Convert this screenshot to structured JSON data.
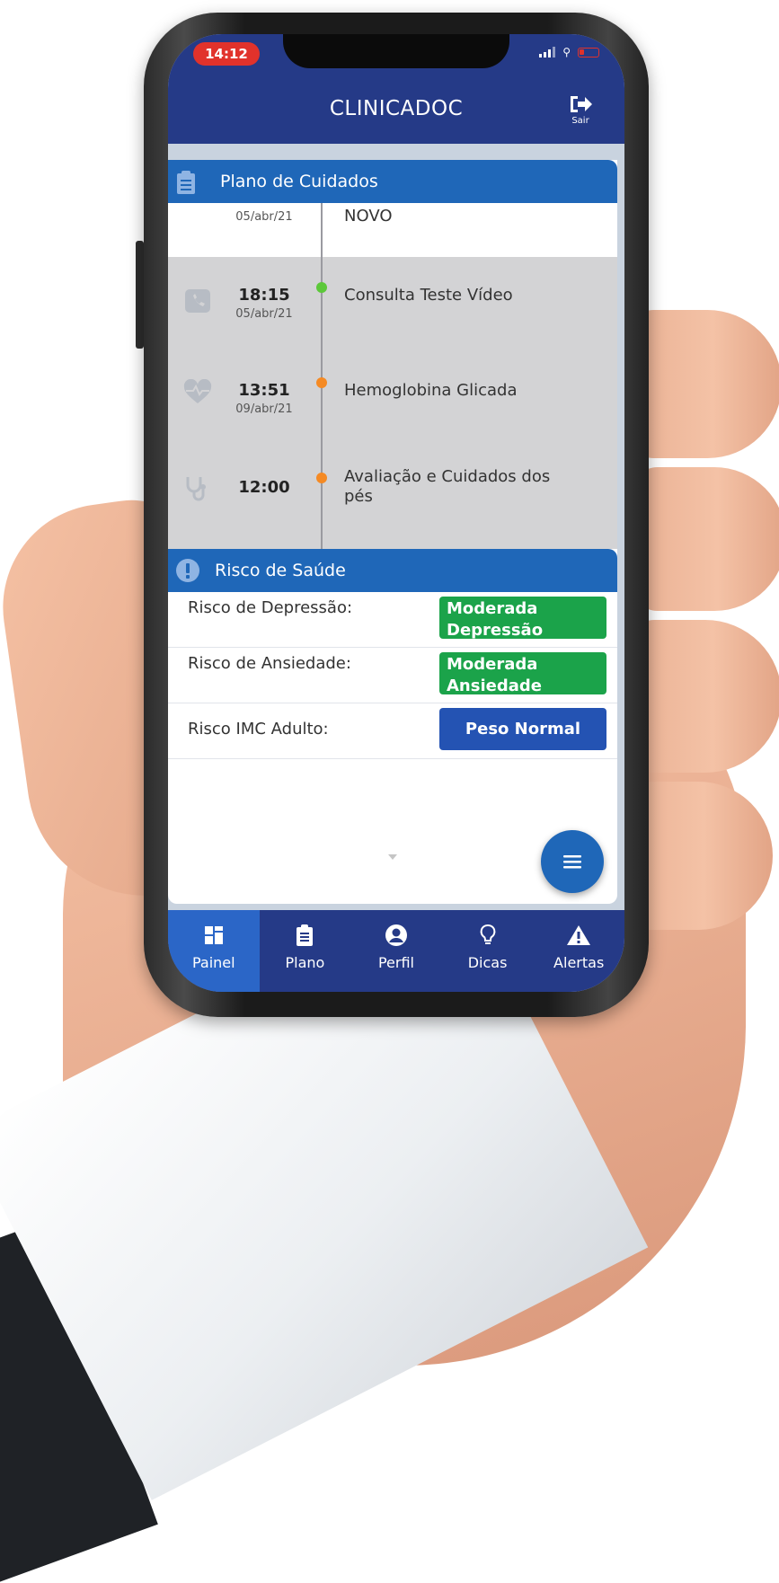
{
  "status_bar": {
    "time": "14:12"
  },
  "header": {
    "app_title": "CLINICADOC",
    "logout_label": "Sair"
  },
  "care_plan": {
    "title": "Plano de Cuidados",
    "items": [
      {
        "time": "",
        "date": "05/abr/21",
        "title": "NOVO",
        "dot_color": ""
      },
      {
        "time": "18:15",
        "date": "05/abr/21",
        "title": "Consulta Teste Vídeo",
        "dot_color": "#5cc83a"
      },
      {
        "time": "13:51",
        "date": "09/abr/21",
        "title": "Hemoglobina Glicada",
        "dot_color": "#f58a24"
      },
      {
        "time": "12:00",
        "date": "",
        "title": "Avaliação e Cuidados dos pés",
        "dot_color": "#f58a24"
      }
    ]
  },
  "health_risk": {
    "title": "Risco de Saúde",
    "rows": [
      {
        "label": "Risco de Depressão:",
        "value": "Moderada Depressão",
        "color": "#1ba34a"
      },
      {
        "label": "Risco de Ansiedade:",
        "value": "Moderada Ansiedade",
        "color": "#1ba34a"
      },
      {
        "label": "Risco IMC Adulto:",
        "value": "Peso Normal",
        "color": "#2453b3"
      }
    ]
  },
  "bottom_nav": {
    "items": [
      {
        "label": "Painel",
        "icon": "dashboard-icon",
        "active": true
      },
      {
        "label": "Plano",
        "icon": "clipboard-icon",
        "active": false
      },
      {
        "label": "Perfil",
        "icon": "user-circle-icon",
        "active": false
      },
      {
        "label": "Dicas",
        "icon": "lightbulb-icon",
        "active": false
      },
      {
        "label": "Alertas",
        "icon": "warning-icon",
        "active": false
      }
    ]
  },
  "colors": {
    "primary": "#253a87",
    "accent": "#1f67b8",
    "nav_active": "#2b66c7"
  }
}
